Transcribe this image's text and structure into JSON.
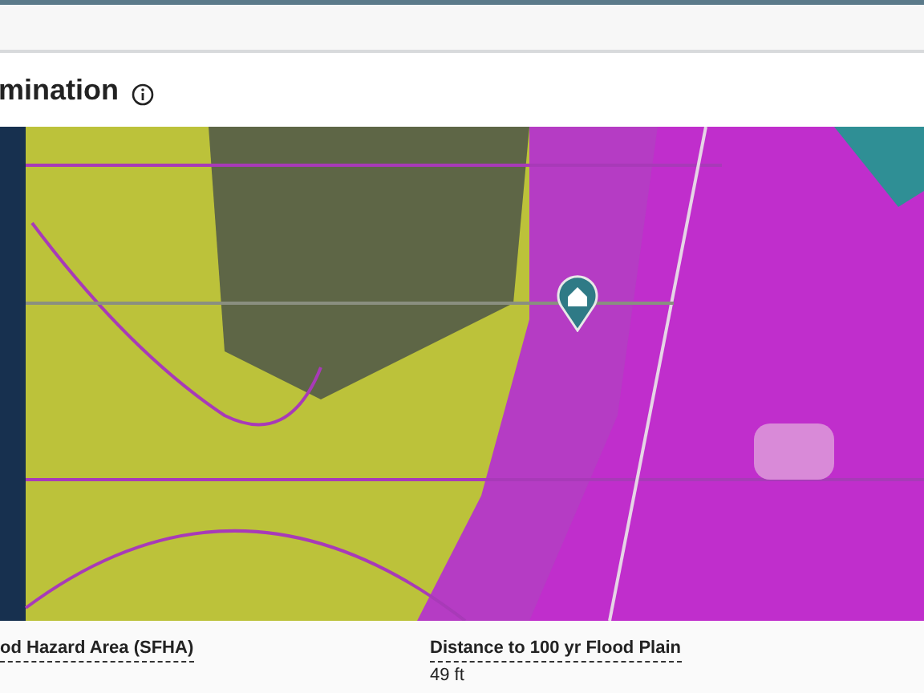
{
  "section": {
    "title": "mination"
  },
  "details": [
    {
      "label": "od Hazard Area (SFHA)"
    },
    {
      "label": "Distance to 100 yr Flood Plain",
      "value": "49 ft"
    }
  ]
}
